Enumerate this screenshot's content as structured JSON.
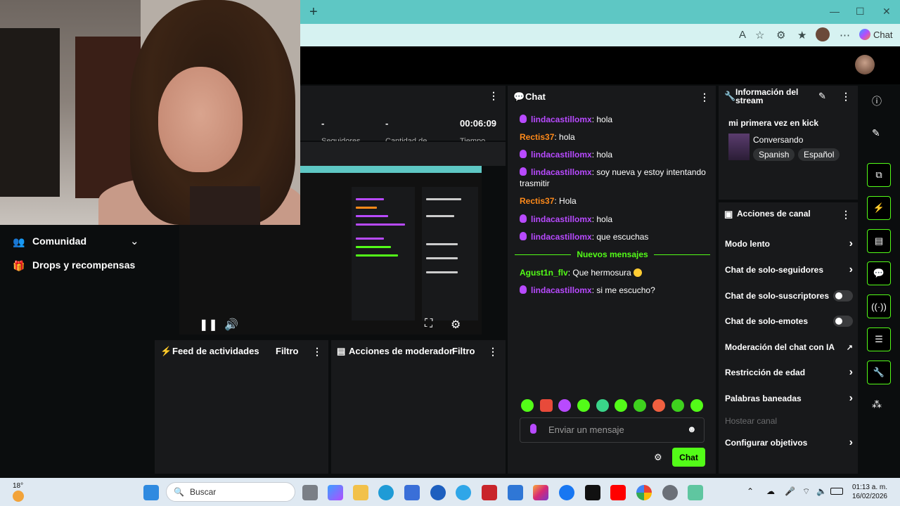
{
  "browser": {
    "new_tab": "+",
    "copilot_label": "Chat",
    "window_controls": [
      "minimize-icon",
      "maximize-icon",
      "close-icon"
    ]
  },
  "stats": {
    "values": [
      "-",
      "-",
      "00:06:09"
    ],
    "labels": [
      "Seguidores",
      "Cantidad de",
      "Tiempo"
    ]
  },
  "sidebar": {
    "items": [
      {
        "label": "Comunidad",
        "icon": "users-icon"
      },
      {
        "label": "Drops y recompensas",
        "icon": "gift-icon"
      }
    ]
  },
  "feed": {
    "title": "Feed de actividades",
    "filter": "Filtro"
  },
  "modactions": {
    "title": "Acciones de moderador",
    "filter": "Filtro"
  },
  "chat": {
    "title": "Chat",
    "messages": [
      {
        "user": "lindacastillomx",
        "text": ": hola",
        "badge": true,
        "color": "purple"
      },
      {
        "user": "Rectis37",
        "text": ": hola",
        "badge": false,
        "color": "orange"
      },
      {
        "user": "lindacastillomx",
        "text": ": hola",
        "badge": true,
        "color": "purple"
      },
      {
        "user": "lindacastillomx",
        "text": ": soy nueva y estoy intentando trasmitir",
        "badge": true,
        "color": "purple"
      },
      {
        "user": "Rectis37",
        "text": ": Hola",
        "badge": false,
        "color": "orange"
      },
      {
        "user": "lindacastillomx",
        "text": ": hola",
        "badge": true,
        "color": "purple"
      },
      {
        "user": "lindacastillomx",
        "text": ": que escuchas",
        "badge": true,
        "color": "purple"
      }
    ],
    "new_messages_label": "Nuevos mensajes",
    "new_messages": [
      {
        "user": "Agust1n_flv",
        "text": ": Que hermosura",
        "badge": false,
        "color": "green",
        "emoji": "heart-eyes-emoji"
      },
      {
        "user": "lindacastillomx",
        "text": ": si me escucho?",
        "badge": true,
        "color": "purple"
      }
    ],
    "input_placeholder": "Enviar un mensaje",
    "send_label": "Chat"
  },
  "stream_info": {
    "title": "Información del stream",
    "stream_title": "mi primera vez en kick",
    "category": "Conversando",
    "tags": [
      "Spanish",
      "Español"
    ]
  },
  "channel_actions": {
    "title": "Acciones de canal",
    "rows": [
      {
        "label": "Modo lento",
        "control": "chevron"
      },
      {
        "label": "Chat de solo-seguidores",
        "control": "chevron"
      },
      {
        "label": "Chat de solo-suscriptores",
        "control": "toggle",
        "on": false
      },
      {
        "label": "Chat de solo-emotes",
        "control": "toggle",
        "on": false
      },
      {
        "label": "Moderación del chat con IA",
        "control": "external"
      },
      {
        "label": "Restricción de edad",
        "control": "chevron"
      },
      {
        "label": "Palabras baneadas",
        "control": "chevron"
      },
      {
        "label": "Hostear canal",
        "control": "none",
        "disabled": true
      },
      {
        "label": "Configurar objetivos",
        "control": "chevron"
      }
    ]
  },
  "taskbar": {
    "weather_temp": "18°",
    "search_placeholder": "Buscar",
    "time": "01:13 a. m.",
    "date": "16/02/2026"
  },
  "colors": {
    "accent": "#53fc18",
    "username_purple": "#b84aff",
    "username_orange": "#ff8a1a"
  }
}
